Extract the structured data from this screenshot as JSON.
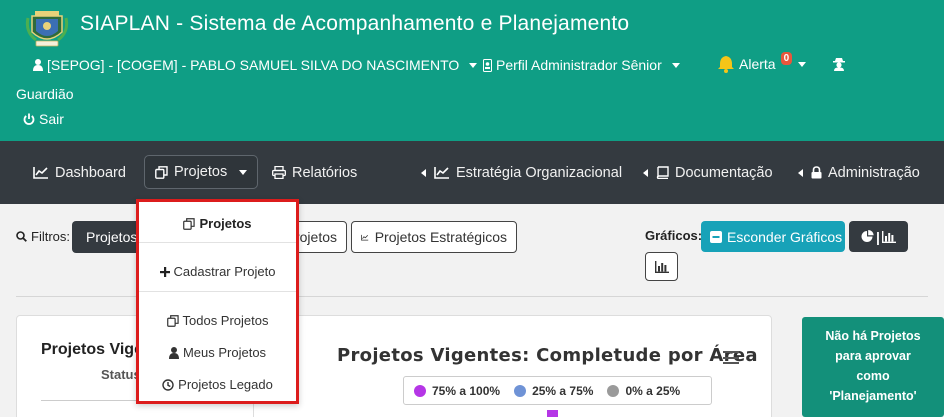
{
  "header": {
    "title": "SIAPLAN - Sistema de Acompanhamento e Planejamento",
    "user": "[SEPOG] - [COGEM] - PABLO SAMUEL SILVA DO NASCIMENTO",
    "profile": "Perfil Administrador Sênior",
    "alert_label": "Alerta",
    "alert_count": "0",
    "guardiao": "Guardião",
    "logout": "Sair"
  },
  "nav": {
    "dashboard": "Dashboard",
    "projetos": "Projetos",
    "relatorios": "Relatórios",
    "estrategia": "Estratégia Organizacional",
    "documentacao": "Documentação",
    "administracao": "Administração"
  },
  "filters": {
    "label": "Filtros:",
    "btn_projetos": "Projetos Vigentes",
    "btn_outro": "Projetos",
    "btn_estrategicos": "Projetos Estratégicos",
    "graficos_label": "Gráficos:",
    "esconder": "Esconder Gráficos"
  },
  "card": {
    "left_title": "Projetos Vigentes",
    "left_sub": "Status",
    "chart_title": "Projetos Vigentes: Completude por Área"
  },
  "chart_data": {
    "type": "bar",
    "title": "Projetos Vigentes: Completude por Área",
    "series": [
      {
        "name": "75% a 100%",
        "color": "#b536e6"
      },
      {
        "name": "25% a 75%",
        "color": "#6f93d6"
      },
      {
        "name": "0% a 25%",
        "color": "#9a9a9a"
      }
    ]
  },
  "side_panel": {
    "lines": [
      "Não há Projetos",
      "para aprovar",
      "como",
      "'Planejamento'"
    ]
  },
  "dropdown": {
    "header": "Projetos",
    "cadastrar": "Cadastrar Projeto",
    "todos": "Todos Projetos",
    "meus": "Meus Projetos",
    "legado": "Projetos Legado"
  },
  "colors": {
    "header_bg": "#0f9e85",
    "nav_bg": "#343a40",
    "accent_teal_button": "#17a2b8",
    "highlight_border": "#dc1c1c"
  }
}
